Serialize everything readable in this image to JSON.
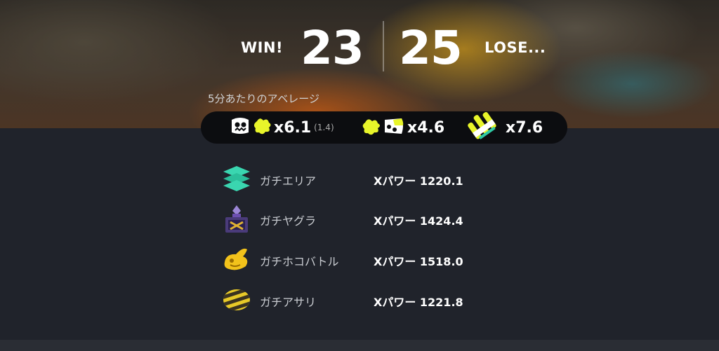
{
  "result": {
    "win_label": "WIN!",
    "win_score": "23",
    "lose_score": "25",
    "lose_label": "LOSE..."
  },
  "averages": {
    "caption": "5分あたりのアベレージ",
    "kills": {
      "icon": "splat-kill-icon",
      "value": "x6.1",
      "sub": "(1.4)"
    },
    "assists": {
      "icon": "assist-icon",
      "value": "x4.6"
    },
    "specials": {
      "icon": "special-icon",
      "value": "x7.6"
    }
  },
  "modes": [
    {
      "icon": "splat-zones-icon",
      "name": "ガチエリア",
      "power": "Xパワー 1220.1"
    },
    {
      "icon": "tower-control-icon",
      "name": "ガチヤグラ",
      "power": "Xパワー 1424.4"
    },
    {
      "icon": "rainmaker-icon",
      "name": "ガチホコバトル",
      "power": "Xパワー 1518.0"
    },
    {
      "icon": "clam-blitz-icon",
      "name": "ガチアサリ",
      "power": "Xパワー 1221.8"
    }
  ],
  "colors": {
    "accent_yellow": "#e8f52a",
    "zones_teal": "#3ad6b0",
    "tower_purple": "#6c4fb0",
    "rainmaker_gold": "#f2c21b",
    "clam_yellow": "#e7c928",
    "panel_bg": "#20232b"
  }
}
